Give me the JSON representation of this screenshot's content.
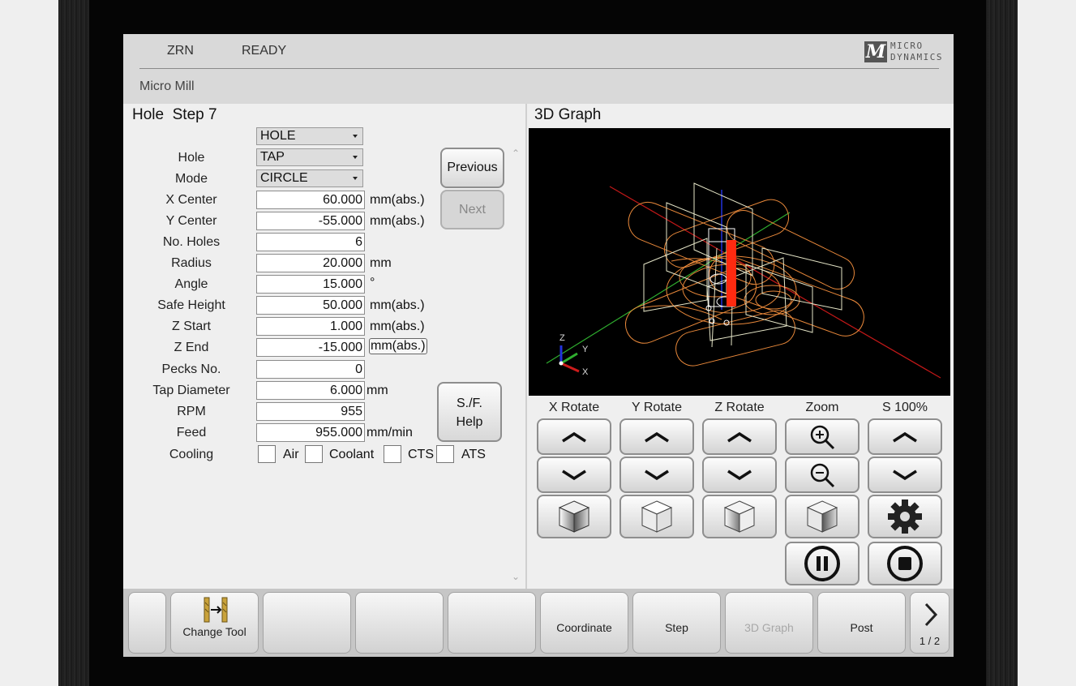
{
  "status": {
    "mode": "ZRN",
    "state": "READY"
  },
  "machine": "Micro Mill",
  "logo": {
    "line1": "MICRO",
    "line2": "DYNAMICS",
    "mark": "M"
  },
  "left_panel": {
    "title": "Hole  Step 7",
    "type_select": "HOLE",
    "fields": {
      "hole": {
        "label": "Hole",
        "value": "TAP"
      },
      "mode": {
        "label": "Mode",
        "value": "CIRCLE"
      },
      "x_center": {
        "label": "X Center",
        "value": "60.000",
        "unit": "mm(abs.)"
      },
      "y_center": {
        "label": "Y Center",
        "value": "-55.000",
        "unit": "mm(abs.)"
      },
      "no_holes": {
        "label": "No. Holes",
        "value": "6"
      },
      "radius": {
        "label": "Radius",
        "value": "20.000",
        "unit": "mm"
      },
      "angle": {
        "label": "Angle",
        "value": "15.000",
        "unit": "°"
      },
      "safe_height": {
        "label": "Safe Height",
        "value": "50.000",
        "unit": "mm(abs.)"
      },
      "z_start": {
        "label": "Z Start",
        "value": "1.000",
        "unit": "mm(abs.)"
      },
      "z_end": {
        "label": "Z End",
        "value": "-15.000",
        "unit": "mm(abs.)"
      },
      "pecks_no": {
        "label": "Pecks No.",
        "value": "0"
      },
      "tap_diameter": {
        "label": "Tap Diameter",
        "value": "6.000",
        "unit": "mm"
      },
      "rpm": {
        "label": "RPM",
        "value": "955"
      },
      "feed": {
        "label": "Feed",
        "value": "955.000",
        "unit": "mm/min"
      }
    },
    "cooling": {
      "label": "Cooling",
      "options": [
        "Air",
        "Coolant",
        "CTS",
        "ATS"
      ]
    },
    "buttons": {
      "previous": "Previous",
      "next": "Next",
      "sf_help_1": "S./F.",
      "sf_help_2": "Help"
    }
  },
  "right_panel": {
    "title": "3D Graph",
    "axis_labels": {
      "x": "X",
      "y": "Y",
      "z": "Z"
    },
    "controls": {
      "x_rotate": "X Rotate",
      "y_rotate": "Y Rotate",
      "z_rotate": "Z Rotate",
      "zoom": "Zoom",
      "speed": "S 100%"
    }
  },
  "footer": {
    "change_tool": "Change Tool",
    "coordinate": "Coordinate",
    "step": "Step",
    "graph3d": "3D Graph",
    "post": "Post",
    "page": "1 / 2"
  },
  "colors": {
    "toolpath": "#e8883a",
    "tool": "#ff2a10",
    "fixture": "#e6e6c8",
    "axis_x": "#cc1b1b",
    "axis_y": "#2fae2f",
    "axis_z": "#2233dd"
  }
}
